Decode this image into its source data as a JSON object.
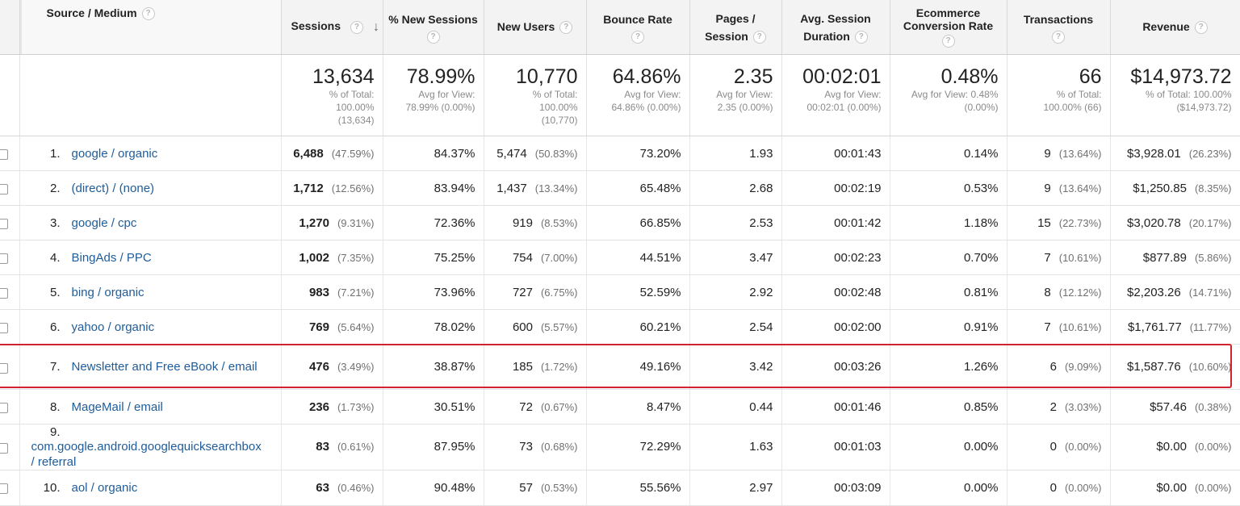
{
  "headers": {
    "source_medium": "Source / Medium",
    "sessions": "Sessions",
    "pct_new_sessions": "% New Sessions",
    "new_users": "New Users",
    "bounce_rate": "Bounce Rate",
    "pages_session_1": "Pages /",
    "pages_session_2": "Session",
    "avg_duration_1": "Avg. Session",
    "avg_duration_2": "Duration",
    "ecommerce_1": "Ecommerce",
    "ecommerce_2": "Conversion Rate",
    "transactions": "Transactions",
    "revenue": "Revenue",
    "help_glyph": "?",
    "sort_glyph": "↓"
  },
  "totals": {
    "sessions": {
      "value": "13,634",
      "l1": "% of Total:",
      "l2": "100.00%",
      "l3": "(13,634)"
    },
    "pct_new_sessions": {
      "value": "78.99%",
      "l1": "Avg for View:",
      "l2": "78.99% (0.00%)"
    },
    "new_users": {
      "value": "10,770",
      "l1": "% of Total:",
      "l2": "100.00%",
      "l3": "(10,770)"
    },
    "bounce_rate": {
      "value": "64.86%",
      "l1": "Avg for View:",
      "l2": "64.86% (0.00%)"
    },
    "pages_session": {
      "value": "2.35",
      "l1": "Avg for View:",
      "l2": "2.35 (0.00%)"
    },
    "avg_duration": {
      "value": "00:02:01",
      "l1": "Avg for View:",
      "l2": "00:02:01 (0.00%)"
    },
    "ecommerce": {
      "value": "0.48%",
      "l1": "Avg for View: 0.48%",
      "l2": "(0.00%)"
    },
    "transactions": {
      "value": "66",
      "l1": "% of Total:",
      "l2": "100.00% (66)"
    },
    "revenue": {
      "value": "$14,973.72",
      "l1": "% of Total: 100.00%",
      "l2": "($14,973.72)"
    }
  },
  "rows": [
    {
      "n": "1.",
      "source": "google / organic",
      "sessions": "6,488",
      "sessions_pct": "(47.59%)",
      "new_sessions": "84.37%",
      "new_users": "5,474",
      "new_users_pct": "(50.83%)",
      "bounce": "73.20%",
      "pages": "1.93",
      "duration": "00:01:43",
      "conv": "0.14%",
      "tx": "9",
      "tx_pct": "(13.64%)",
      "revenue": "$3,928.01",
      "revenue_pct": "(26.23%)"
    },
    {
      "n": "2.",
      "source": "(direct) / (none)",
      "sessions": "1,712",
      "sessions_pct": "(12.56%)",
      "new_sessions": "83.94%",
      "new_users": "1,437",
      "new_users_pct": "(13.34%)",
      "bounce": "65.48%",
      "pages": "2.68",
      "duration": "00:02:19",
      "conv": "0.53%",
      "tx": "9",
      "tx_pct": "(13.64%)",
      "revenue": "$1,250.85",
      "revenue_pct": "(8.35%)"
    },
    {
      "n": "3.",
      "source": "google / cpc",
      "sessions": "1,270",
      "sessions_pct": "(9.31%)",
      "new_sessions": "72.36%",
      "new_users": "919",
      "new_users_pct": "(8.53%)",
      "bounce": "66.85%",
      "pages": "2.53",
      "duration": "00:01:42",
      "conv": "1.18%",
      "tx": "15",
      "tx_pct": "(22.73%)",
      "revenue": "$3,020.78",
      "revenue_pct": "(20.17%)"
    },
    {
      "n": "4.",
      "source": "BingAds / PPC",
      "sessions": "1,002",
      "sessions_pct": "(7.35%)",
      "new_sessions": "75.25%",
      "new_users": "754",
      "new_users_pct": "(7.00%)",
      "bounce": "44.51%",
      "pages": "3.47",
      "duration": "00:02:23",
      "conv": "0.70%",
      "tx": "7",
      "tx_pct": "(10.61%)",
      "revenue": "$877.89",
      "revenue_pct": "(5.86%)"
    },
    {
      "n": "5.",
      "source": "bing / organic",
      "sessions": "983",
      "sessions_pct": "(7.21%)",
      "new_sessions": "73.96%",
      "new_users": "727",
      "new_users_pct": "(6.75%)",
      "bounce": "52.59%",
      "pages": "2.92",
      "duration": "00:02:48",
      "conv": "0.81%",
      "tx": "8",
      "tx_pct": "(12.12%)",
      "revenue": "$2,203.26",
      "revenue_pct": "(14.71%)"
    },
    {
      "n": "6.",
      "source": "yahoo / organic",
      "sessions": "769",
      "sessions_pct": "(5.64%)",
      "new_sessions": "78.02%",
      "new_users": "600",
      "new_users_pct": "(5.57%)",
      "bounce": "60.21%",
      "pages": "2.54",
      "duration": "00:02:00",
      "conv": "0.91%",
      "tx": "7",
      "tx_pct": "(10.61%)",
      "revenue": "$1,761.77",
      "revenue_pct": "(11.77%)"
    },
    {
      "n": "7.",
      "source": "Newsletter and Free eBook / email",
      "sessions": "476",
      "sessions_pct": "(3.49%)",
      "new_sessions": "38.87%",
      "new_users": "185",
      "new_users_pct": "(1.72%)",
      "bounce": "49.16%",
      "pages": "3.42",
      "duration": "00:03:26",
      "conv": "1.26%",
      "tx": "6",
      "tx_pct": "(9.09%)",
      "revenue": "$1,587.76",
      "revenue_pct": "(10.60%)"
    },
    {
      "n": "8.",
      "source": "MageMail / email",
      "sessions": "236",
      "sessions_pct": "(1.73%)",
      "new_sessions": "30.51%",
      "new_users": "72",
      "new_users_pct": "(0.67%)",
      "bounce": "8.47%",
      "pages": "0.44",
      "duration": "00:01:46",
      "conv": "0.85%",
      "tx": "2",
      "tx_pct": "(3.03%)",
      "revenue": "$57.46",
      "revenue_pct": "(0.38%)"
    },
    {
      "n": "9.",
      "source": "com.google.android.googlequicksearchbox / referral",
      "sessions": "83",
      "sessions_pct": "(0.61%)",
      "new_sessions": "87.95%",
      "new_users": "73",
      "new_users_pct": "(0.68%)",
      "bounce": "72.29%",
      "pages": "1.63",
      "duration": "00:01:03",
      "conv": "0.00%",
      "tx": "0",
      "tx_pct": "(0.00%)",
      "revenue": "$0.00",
      "revenue_pct": "(0.00%)"
    },
    {
      "n": "10.",
      "source": "aol / organic",
      "sessions": "63",
      "sessions_pct": "(0.46%)",
      "new_sessions": "90.48%",
      "new_users": "57",
      "new_users_pct": "(0.53%)",
      "bounce": "55.56%",
      "pages": "2.97",
      "duration": "00:03:09",
      "conv": "0.00%",
      "tx": "0",
      "tx_pct": "(0.00%)",
      "revenue": "$0.00",
      "revenue_pct": "(0.00%)"
    }
  ],
  "colors": {
    "link": "#1f5c9a",
    "highlight": "#d0232e",
    "header_bg": "#f3f3f3"
  },
  "icons": {
    "help": "help-circle-icon",
    "sort": "sort-desc-arrow-icon",
    "checkbox": "row-checkbox-icon"
  }
}
